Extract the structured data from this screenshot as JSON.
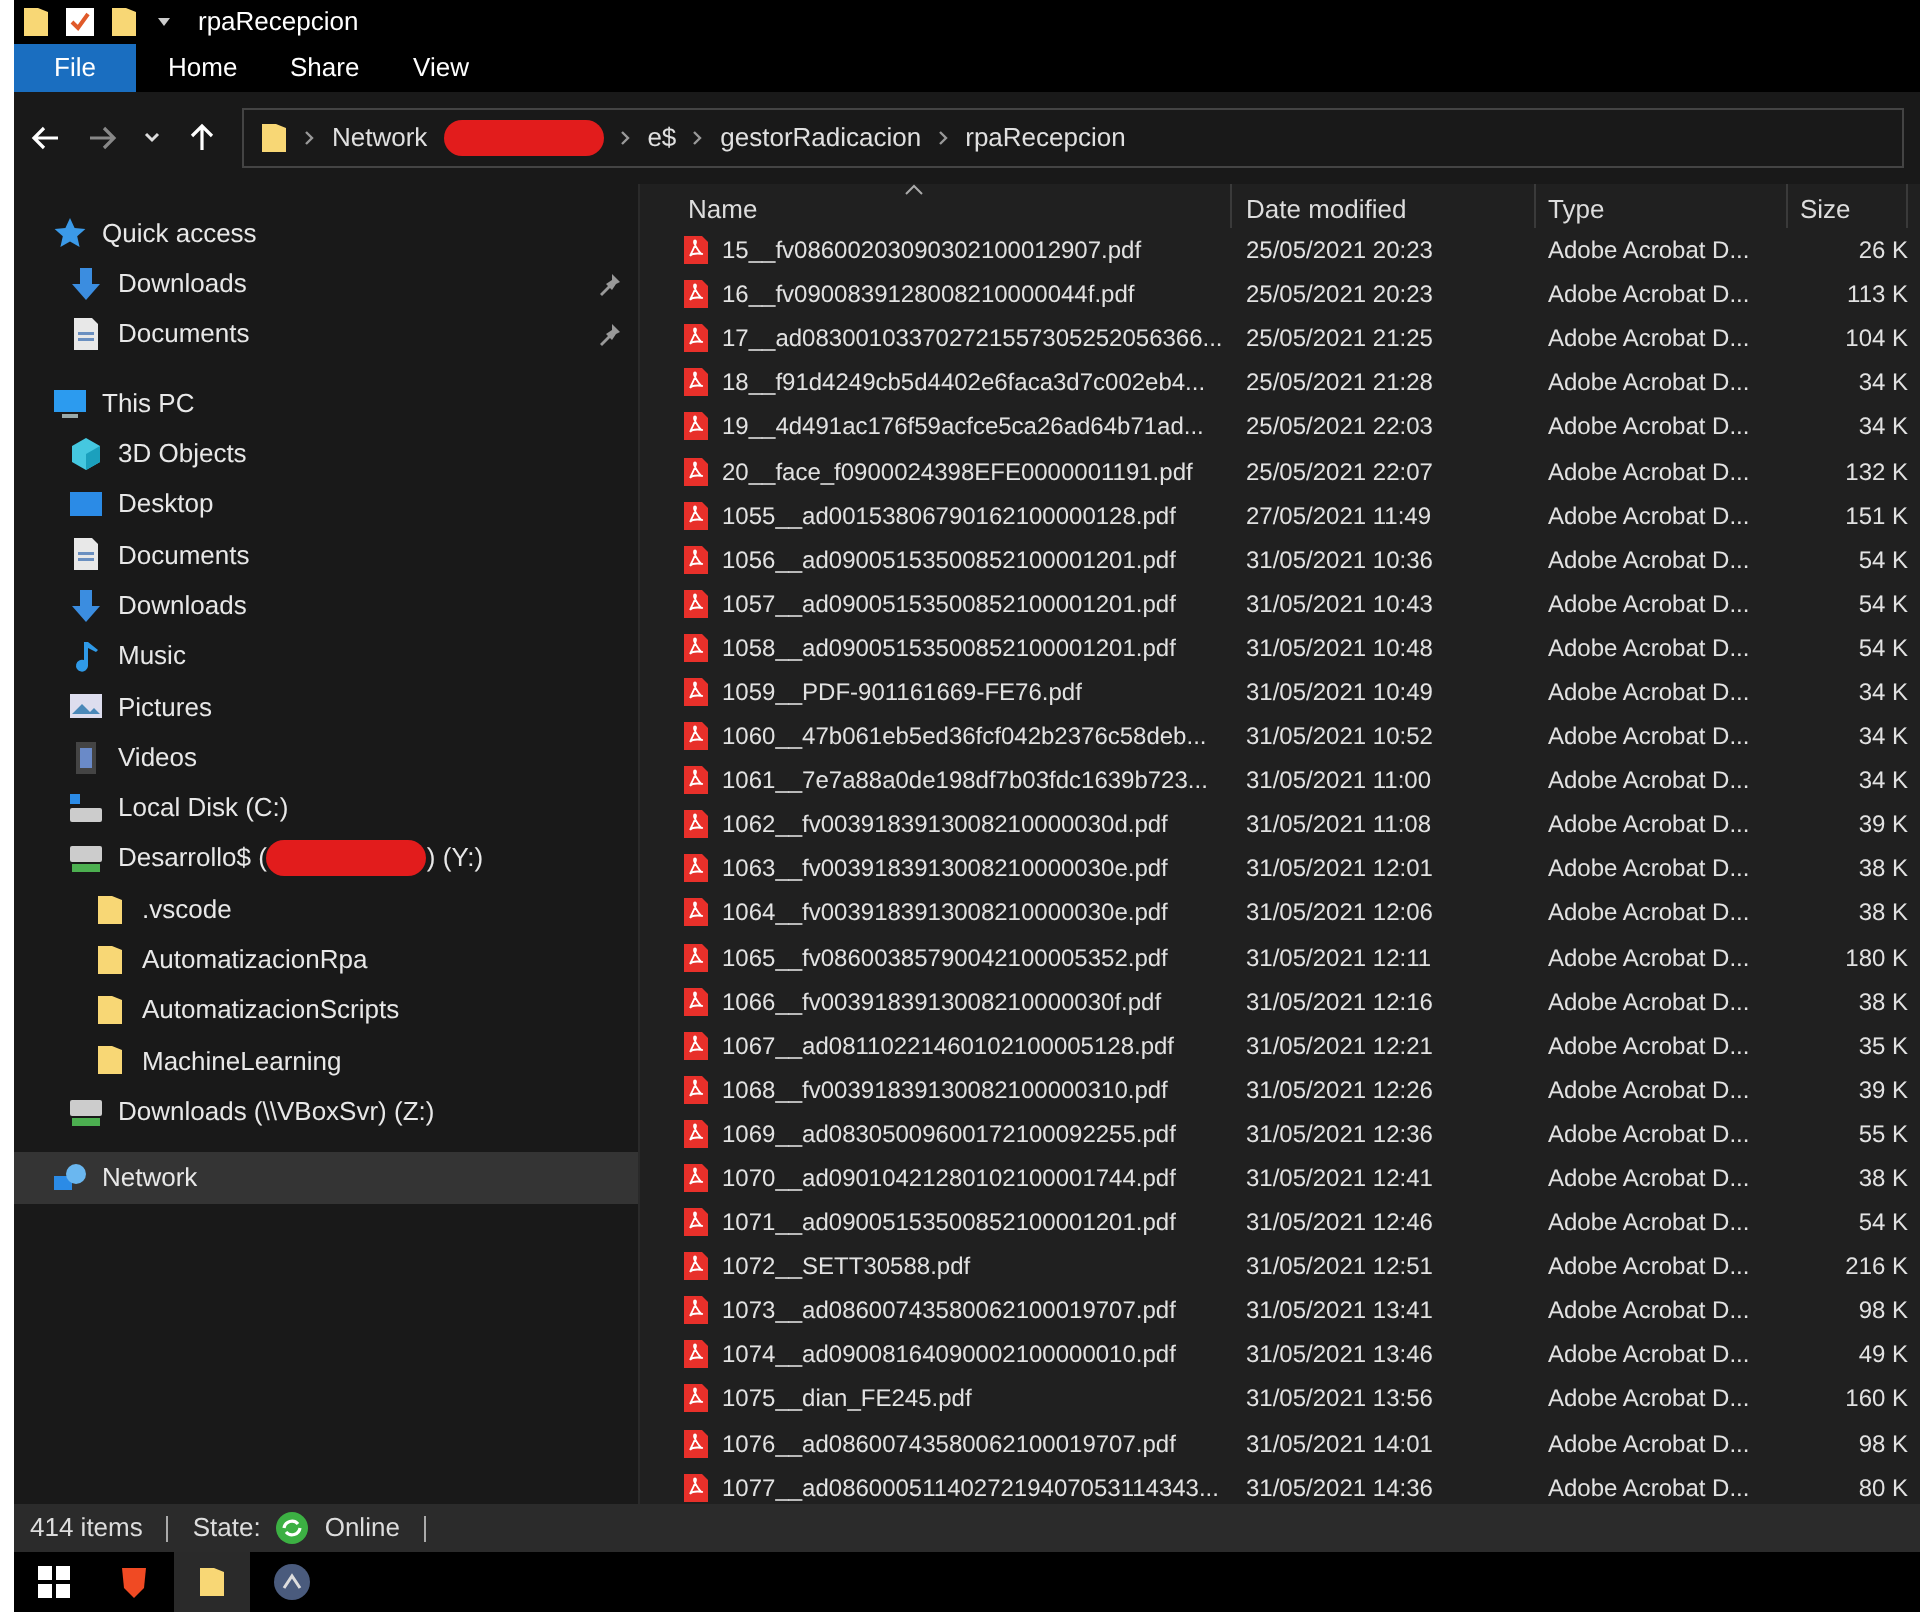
{
  "window": {
    "title": "rpaRecepcion"
  },
  "ribbon_tabs": [
    {
      "label": "File",
      "selected": true
    },
    {
      "label": "Home",
      "selected": false
    },
    {
      "label": "Share",
      "selected": false
    },
    {
      "label": "View",
      "selected": false
    }
  ],
  "address_bar": {
    "crumbs": [
      {
        "label": "Network",
        "redacted_after": true
      },
      {
        "label": "e$",
        "redacted_after": false
      },
      {
        "label": "gestorRadicacion",
        "redacted_after": false
      },
      {
        "label": "rpaRecepcion",
        "redacted_after": false
      }
    ]
  },
  "sidebar": {
    "items": [
      {
        "label": "Quick access",
        "selected": false,
        "children": [
          {
            "label": "Downloads",
            "pinned": true,
            "selected": false
          },
          {
            "label": "Documents",
            "pinned": true,
            "selected": false
          }
        ]
      },
      {
        "label": "This PC",
        "selected": false,
        "children": [
          {
            "label": "3D Objects",
            "selected": false
          },
          {
            "label": "Desktop",
            "selected": false
          },
          {
            "label": "Documents",
            "selected": false
          },
          {
            "label": "Downloads",
            "selected": false
          },
          {
            "label": "Music",
            "selected": false
          },
          {
            "label": "Pictures",
            "selected": false
          },
          {
            "label": "Videos",
            "selected": false
          },
          {
            "label": "Local Disk (C:)",
            "selected": false
          },
          {
            "label": "Desarrollo$ (",
            "label_after": ") (Y:)",
            "selected": false,
            "children": [
              {
                "label": ".vscode",
                "selected": false
              },
              {
                "label": "AutomatizacionRpa",
                "selected": false
              },
              {
                "label": "AutomatizacionScripts",
                "selected": false
              },
              {
                "label": "MachineLearning",
                "selected": false
              }
            ]
          },
          {
            "label": "Downloads (\\\\VBoxSvr) (Z:)",
            "selected": false
          }
        ]
      },
      {
        "label": "Network",
        "selected": true
      }
    ]
  },
  "table": {
    "columns": [
      "Name",
      "Date modified",
      "Type",
      "Size"
    ],
    "rows": [
      [
        "15__fv08600203090302100012907.pdf",
        "25/05/2021 20:23",
        "Adobe Acrobat D...",
        "26 K"
      ],
      [
        "16__fv0900839128008210000044f.pdf",
        "25/05/2021 20:23",
        "Adobe Acrobat D...",
        "113 K"
      ],
      [
        "17__ad083001033702721557305252056366...",
        "25/05/2021 21:25",
        "Adobe Acrobat D...",
        "104 K"
      ],
      [
        "18__f91d4249cb5d4402e6faca3d7c002eb4...",
        "25/05/2021 21:28",
        "Adobe Acrobat D...",
        "34 K"
      ],
      [
        "19__4d491ac176f59acfce5ca26ad64b71ad...",
        "25/05/2021 22:03",
        "Adobe Acrobat D...",
        "34 K"
      ],
      [
        "20__face_f0900024398EFE0000001191.pdf",
        "25/05/2021 22:07",
        "Adobe Acrobat D...",
        "132 K"
      ],
      [
        "1055__ad00153806790162100000128.pdf",
        "27/05/2021 11:49",
        "Adobe Acrobat D...",
        "151 K"
      ],
      [
        "1056__ad09005153500852100001201.pdf",
        "31/05/2021 10:36",
        "Adobe Acrobat D...",
        "54 K"
      ],
      [
        "1057__ad09005153500852100001201.pdf",
        "31/05/2021 10:43",
        "Adobe Acrobat D...",
        "54 K"
      ],
      [
        "1058__ad09005153500852100001201.pdf",
        "31/05/2021 10:48",
        "Adobe Acrobat D...",
        "54 K"
      ],
      [
        "1059__PDF-901161669-FE76.pdf",
        "31/05/2021 10:49",
        "Adobe Acrobat D...",
        "34 K"
      ],
      [
        "1060__47b061eb5ed36fcf042b2376c58deb...",
        "31/05/2021 10:52",
        "Adobe Acrobat D...",
        "34 K"
      ],
      [
        "1061__7e7a88a0de198df7b03fdc1639b723...",
        "31/05/2021 11:00",
        "Adobe Acrobat D...",
        "34 K"
      ],
      [
        "1062__fv0039183913008210000030d.pdf",
        "31/05/2021 11:08",
        "Adobe Acrobat D...",
        "39 K"
      ],
      [
        "1063__fv0039183913008210000030e.pdf",
        "31/05/2021 12:01",
        "Adobe Acrobat D...",
        "38 K"
      ],
      [
        "1064__fv0039183913008210000030e.pdf",
        "31/05/2021 12:06",
        "Adobe Acrobat D...",
        "38 K"
      ],
      [
        "1065__fv08600385790042100005352.pdf",
        "31/05/2021 12:11",
        "Adobe Acrobat D...",
        "180 K"
      ],
      [
        "1066__fv0039183913008210000030f.pdf",
        "31/05/2021 12:16",
        "Adobe Acrobat D...",
        "38 K"
      ],
      [
        "1067__ad08110221460102100005128.pdf",
        "31/05/2021 12:21",
        "Adobe Acrobat D...",
        "35 K"
      ],
      [
        "1068__fv00391839130082100000310.pdf",
        "31/05/2021 12:26",
        "Adobe Acrobat D...",
        "39 K"
      ],
      [
        "1069__ad08305009600172100092255.pdf",
        "31/05/2021 12:36",
        "Adobe Acrobat D...",
        "55 K"
      ],
      [
        "1070__ad09010421280102100001744.pdf",
        "31/05/2021 12:41",
        "Adobe Acrobat D...",
        "38 K"
      ],
      [
        "1071__ad09005153500852100001201.pdf",
        "31/05/2021 12:46",
        "Adobe Acrobat D...",
        "54 K"
      ],
      [
        "1072__SETT30588.pdf",
        "31/05/2021 12:51",
        "Adobe Acrobat D...",
        "216 K"
      ],
      [
        "1073__ad08600743580062100019707.pdf",
        "31/05/2021 13:41",
        "Adobe Acrobat D...",
        "98 K"
      ],
      [
        "1074__ad09008164090002100000010.pdf",
        "31/05/2021 13:46",
        "Adobe Acrobat D...",
        "49 K"
      ],
      [
        "1075__dian_FE245.pdf",
        "31/05/2021 13:56",
        "Adobe Acrobat D...",
        "160 K"
      ],
      [
        "1076__ad08600743580062100019707.pdf",
        "31/05/2021 14:01",
        "Adobe Acrobat D...",
        "98 K"
      ],
      [
        "1077__ad0860005114027219407053114343...",
        "31/05/2021 14:36",
        "Adobe Acrobat D...",
        "80 K"
      ]
    ]
  },
  "status_bar": {
    "count": "414 items",
    "state_label": "State:",
    "state_value": "Online"
  }
}
